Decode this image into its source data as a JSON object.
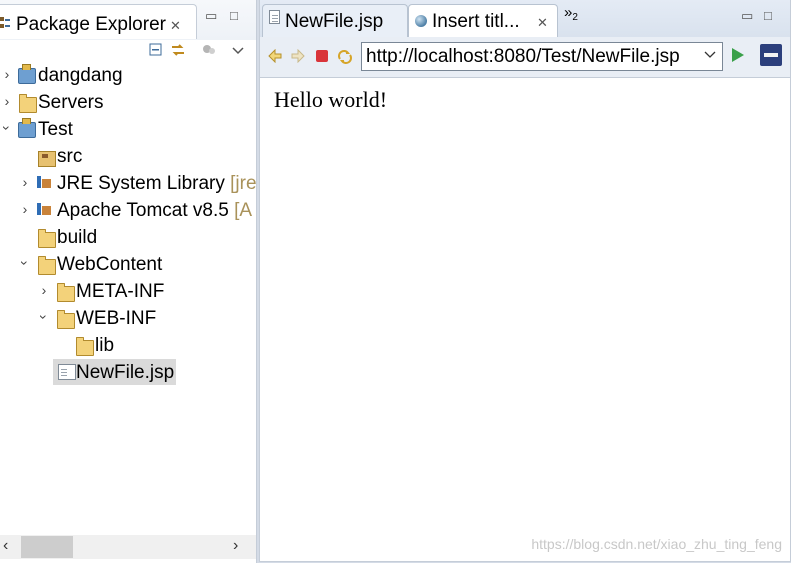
{
  "left_view": {
    "title": "Package Explorer",
    "close_glyph": "✕",
    "minimize_glyph": "▭",
    "maximize_glyph": "□"
  },
  "tree": [
    {
      "label": "dangdang",
      "icon": "project-icon",
      "expanded": false
    },
    {
      "label": "Servers",
      "icon": "folder-icon",
      "expanded": false
    },
    {
      "label": "Test",
      "icon": "project-icon",
      "expanded": true
    },
    {
      "label": "src",
      "icon": "source-folder-icon"
    },
    {
      "label": "JRE System Library",
      "decoration": "[jre",
      "icon": "library-icon",
      "expanded": false
    },
    {
      "label": "Apache Tomcat v8.5",
      "decoration": "[A",
      "icon": "library-icon",
      "expanded": false
    },
    {
      "label": "build",
      "icon": "folder-icon"
    },
    {
      "label": "WebContent",
      "icon": "folder-icon",
      "expanded": true
    },
    {
      "label": "META-INF",
      "icon": "folder-icon",
      "expanded": false
    },
    {
      "label": "WEB-INF",
      "icon": "folder-icon",
      "expanded": true
    },
    {
      "label": "lib",
      "icon": "folder-icon"
    },
    {
      "label": "NewFile.jsp",
      "icon": "file-icon",
      "selected": true
    }
  ],
  "editor": {
    "tabs": [
      {
        "label": "NewFile.jsp",
        "active": false
      },
      {
        "label": "Insert titl...",
        "active": true
      }
    ],
    "overflow_label": "»",
    "overflow_count": "2"
  },
  "browser": {
    "url": "http://localhost:8080/Test/NewFile.jsp",
    "content_text": "Hello world!"
  },
  "watermark": "https://blog.csdn.net/xiao_zhu_ting_feng",
  "colors": {
    "selection": "#dadada",
    "decoration": "#a9925a",
    "go_button": "#3aa04a"
  }
}
